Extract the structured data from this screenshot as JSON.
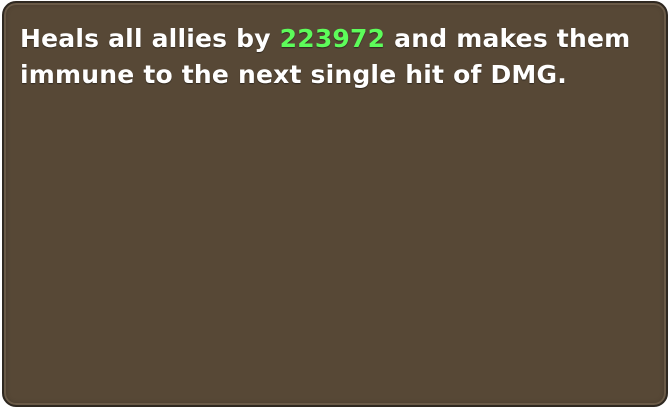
{
  "tooltip": {
    "line1_before": "Heals all allies by ",
    "heal_amount": "223972",
    "line1_after": " and makes them",
    "line2": "immune to the next single hit of DMG."
  },
  "colors": {
    "panel_bg": "#574836",
    "panel_border": "#2f2820",
    "text": "#ffffff",
    "highlight": "#5dfc5a"
  }
}
